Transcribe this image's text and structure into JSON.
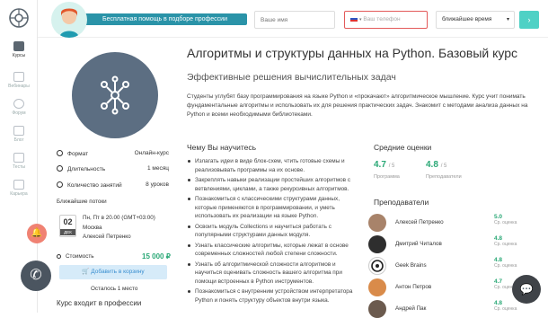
{
  "sidebar": {
    "items": [
      {
        "label": "Курсы",
        "icon": "book-icon",
        "active": true
      },
      {
        "label": "Вебинары",
        "icon": "video-icon",
        "active": false
      },
      {
        "label": "Форум",
        "icon": "forum-icon",
        "active": false
      },
      {
        "label": "Блог",
        "icon": "blog-icon",
        "active": false
      },
      {
        "label": "Тесты",
        "icon": "tests-icon",
        "active": false
      },
      {
        "label": "Карьера",
        "icon": "career-icon",
        "active": false
      }
    ]
  },
  "header": {
    "promo": "Бесплатная помощь в подборе профессии",
    "name_placeholder": "Ваше имя",
    "phone_placeholder": "Ваш телефон",
    "time_select": "ближайшее время",
    "submit_icon": "chevron-right-icon"
  },
  "course": {
    "title": "Алгоритмы и структуры данных на Python. Базовый курс",
    "subtitle": "Эффективные решения вычислительных задач",
    "description": "Студенты углубят базу программирования на языке Python и «прокачают» алгоритмическое мышление. Курс учит понимать фундаментальные алгоритмы и использовать их для решения практических задач. Знакомит с методами анализа данных на Python и всеми необходимыми библиотеками."
  },
  "info": {
    "format_label": "Формат",
    "format_value": "Онлайн-курс",
    "duration_label": "Длительность",
    "duration_value": "1 месяц",
    "lessons_label": "Количество занятий",
    "lessons_value": "8 уроков",
    "streams_title": "Ближайшие потоки",
    "date_day": "02",
    "date_month": "ДЕК",
    "schedule": "Пн, Пт в 20.00 (GMT+03:00)",
    "city": "Москва",
    "teacher": "Алексей Петренко",
    "price_label": "Стоимость",
    "price": "15 000 ₽",
    "cart_button": "Добавить в корзину",
    "seats_left": "Осталось 1 место",
    "program_title": "Курс входит в профессии"
  },
  "learn": {
    "title": "Чему Вы научитесь",
    "items": [
      "Излагать идеи в виде блок-схем, чтить готовые схемы и реализовывать программы на их основе.",
      "Закреплять навыки реализации простейших алгоритмов с ветвлениями, циклами, а также рекурсивных алгоритмов.",
      "Познакомиться с классическими структурами данных, которые применяются в программировании, и уметь использовать их реализации на языке Python.",
      "Освоить модуль Collections и научиться работать с популярными структурами данных модуля.",
      "Узнать классические алгоритмы, которые лежат в основе современных сложностей любой степени сложности.",
      "Узнать об алгоритмической сложности алгоритмов и научиться оценивать сложность вашего алгоритма при помощи встроенных в Python инструментов.",
      "Познакомиться с внутренним устройством интерпретатора Python и понять структуру объектов внутри языка."
    ]
  },
  "ratings": {
    "title": "Средние оценки",
    "program_value": "4.7",
    "program_of": "/ 5",
    "program_label": "Программа",
    "teachers_value": "4.8",
    "teachers_of": "/ 5",
    "teachers_label": "Преподаватели"
  },
  "teachers": {
    "title": "Преподаватели",
    "list": [
      {
        "name": "Алексей Петренко",
        "score": "5.0",
        "score_label": "Ср. оценка"
      },
      {
        "name": "Дмитрий Читалов",
        "score": "4.8",
        "score_label": "Ср. оценка"
      },
      {
        "name": "Geek Brains",
        "score": "4.8",
        "score_label": "Ср. оценка"
      },
      {
        "name": "Антон Петров",
        "score": "4.7",
        "score_label": "Ср. оценка"
      },
      {
        "name": "Андрей Пак",
        "score": "4.8",
        "score_label": "Ср. оценка"
      }
    ]
  },
  "colors": {
    "accent": "#2aa876",
    "cta": "#4fd1c5",
    "bell": "#f08273"
  }
}
